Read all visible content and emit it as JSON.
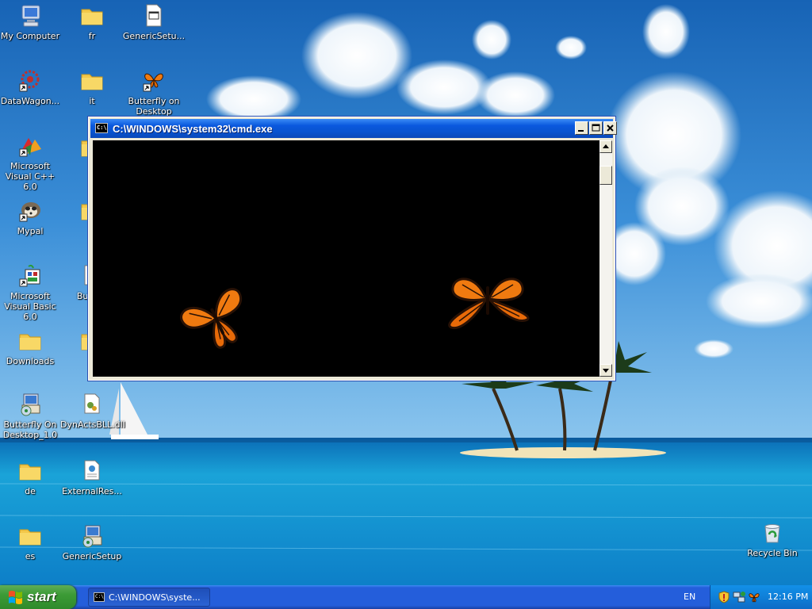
{
  "desktop": {
    "icons": [
      {
        "label": "My Computer",
        "icon": "computer-icon"
      },
      {
        "label": "fr",
        "icon": "folder-icon"
      },
      {
        "label": "GenericSetu...",
        "icon": "executable-window-icon"
      },
      {
        "label": "DataWagon...",
        "icon": "datawagon-shortcut-icon"
      },
      {
        "label": "it",
        "icon": "folder-icon"
      },
      {
        "label": "Butterfly on Desktop",
        "icon": "butterfly-shortcut-icon"
      },
      {
        "label": "Microsoft Visual C++ 6.0",
        "icon": "visual-cpp-shortcut-icon"
      },
      {
        "label": "Mypal",
        "icon": "mypal-shortcut-icon"
      },
      {
        "label": "Microsoft Visual Basic 6.0",
        "icon": "visual-basic-shortcut-icon"
      },
      {
        "label": "Bundle",
        "icon": "document-icon"
      },
      {
        "label": "Downloads",
        "icon": "folder-icon"
      },
      {
        "label": "Butterfly On Desktop_1.0",
        "icon": "installer-icon"
      },
      {
        "label": "DynActsBLL.dll",
        "icon": "dll-file-icon"
      },
      {
        "label": "de",
        "icon": "folder-icon"
      },
      {
        "label": "ExternalRes...",
        "icon": "config-file-icon"
      },
      {
        "label": "es",
        "icon": "folder-icon"
      },
      {
        "label": "GenericSetup",
        "icon": "installer-icon"
      },
      {
        "label": "Recycle Bin",
        "icon": "recycle-bin-icon"
      }
    ]
  },
  "window": {
    "title": "C:\\WINDOWS\\system32\\cmd.exe",
    "app_icon_text": "C:\\",
    "buttons": {
      "minimize": "minimize-icon",
      "maximize": "maximize-icon",
      "close": "close-icon"
    },
    "console_bg": "#000000",
    "scrollbar": {
      "up": "scroll-up-arrow-icon",
      "down": "scroll-down-arrow-icon"
    }
  },
  "taskbar": {
    "start_label": "start",
    "task_items": [
      {
        "label": "C:\\WINDOWS\\syste..."
      }
    ],
    "language": "EN",
    "tray_icons": [
      "shield-icon",
      "network-icon",
      "butterfly-tray-icon"
    ],
    "clock": "12:16 PM"
  },
  "colors": {
    "taskbar_blue": "#245edb",
    "start_green": "#3c9b36",
    "title_blue": "#0a58de",
    "butterfly_orange": "#f07a10"
  }
}
